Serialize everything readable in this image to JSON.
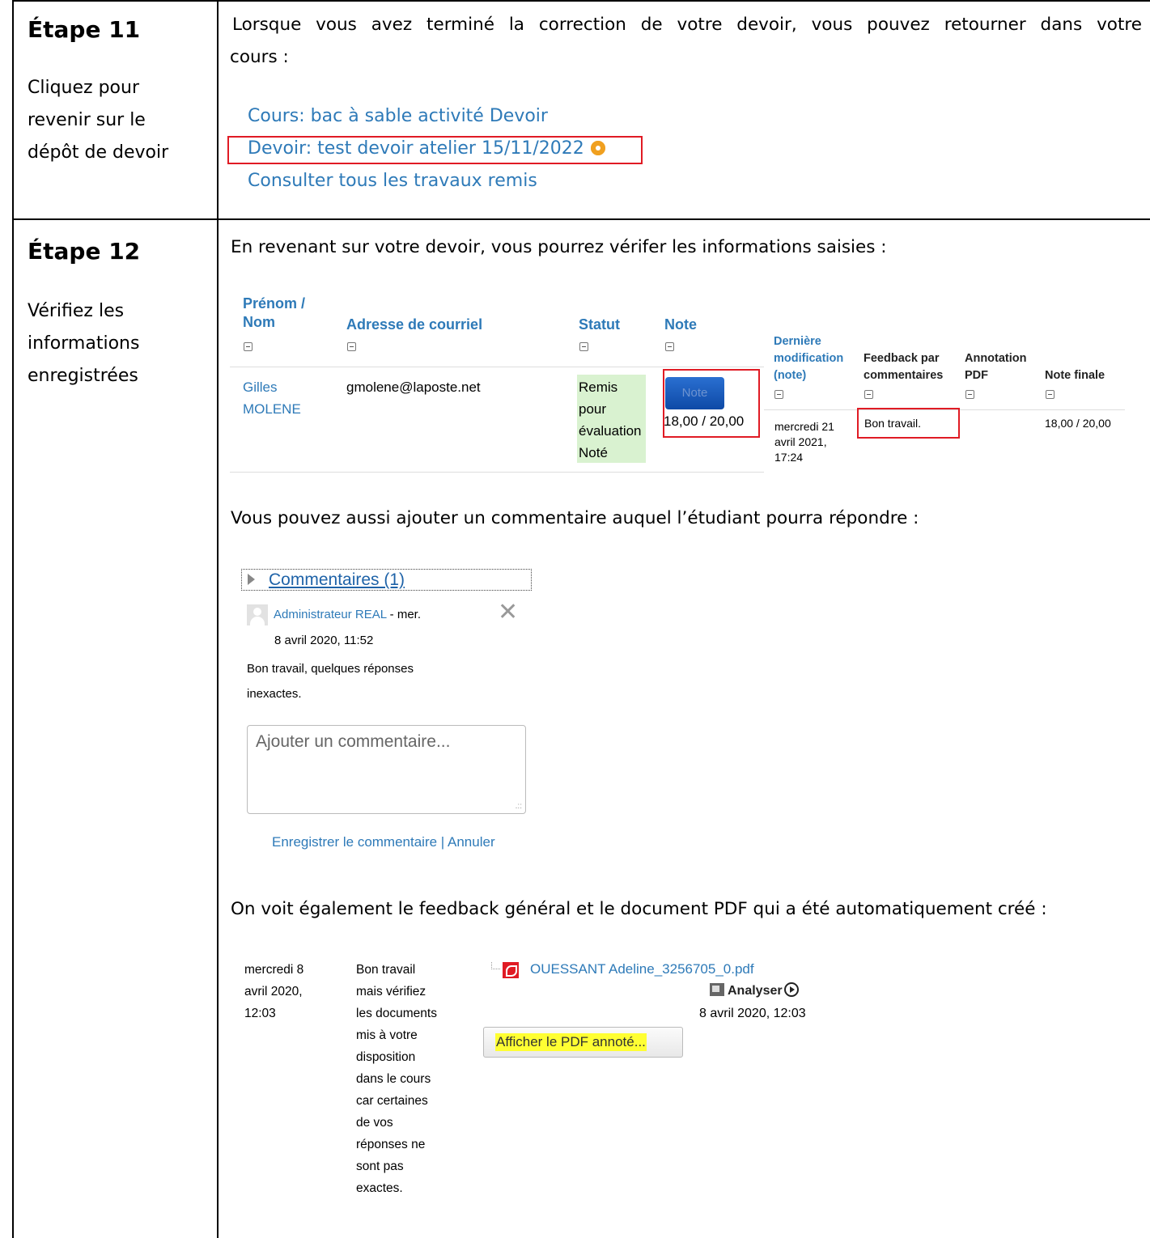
{
  "step11": {
    "title": "Étape 11",
    "subtitle_lines": [
      "Cliquez pour",
      "revenir sur le",
      "dépôt de devoir"
    ],
    "intro_lines": [
      "Lorsque vous avez terminé la correction de votre devoir, vous pouvez retourner dans votre",
      "cours :"
    ],
    "links": {
      "course": "Cours: bac à sable activité Devoir",
      "assignment": "Devoir: test devoir atelier 15/11/2022",
      "view_all": "Consulter tous les travaux remis"
    },
    "gear_icon": "gear-icon"
  },
  "step12": {
    "title": "Étape 12",
    "subtitle_lines": [
      "Vérifiez les",
      "informations",
      "enregistrées"
    ],
    "intro": "En revenant sur votre devoir, vous pourrez vérifer les informations saisies :",
    "table": {
      "headers": {
        "name": [
          "Prénom /",
          "Nom"
        ],
        "email": "Adresse de courriel",
        "status": "Statut",
        "grade": "Note",
        "last_modified": [
          "Dernière",
          "modification",
          "(note)"
        ],
        "feedback": [
          "Feedback par",
          "commentaires"
        ],
        "pdf_annotation": [
          "Annotation",
          "PDF"
        ],
        "final_grade": "Note finale"
      },
      "row": {
        "name": [
          "Gilles",
          "MOLENE"
        ],
        "email": "gmolene@laposte.net",
        "status": [
          "Remis",
          "pour",
          "évaluation",
          "Noté"
        ],
        "grade_button": "Note",
        "grade": "18,00 / 20,00",
        "last_modified": [
          "mercredi 21",
          "avril 2021,",
          "17:24"
        ],
        "feedback": "Bon travail.",
        "final_grade": "18,00 / 20,00"
      }
    },
    "comment_intro": "Vous pouvez aussi ajouter un commentaire auquel l’étudiant pourra répondre :",
    "comments": {
      "header": "Commentaires (1)",
      "author": "Administrateur REAL",
      "date_prefix": " - mer.",
      "date": "8 avril 2020, 11:52",
      "text_lines": [
        "Bon travail, quelques réponses",
        "inexactes."
      ],
      "placeholder": "Ajouter un commentaire...",
      "save": "Enregistrer le commentaire",
      "separator": " | ",
      "cancel": "Annuler"
    },
    "feedback_intro": "On voit également le feedback général et le document PDF qui a été automatiquement créé :",
    "feedback": {
      "date_lines": [
        "mercredi 8",
        "avril 2020,",
        "12:03"
      ],
      "text_lines": [
        "Bon travail",
        "mais vérifiez",
        "les documents",
        "mis à votre",
        "disposition",
        "dans le cours",
        "car certaines",
        "de vos",
        "réponses ne",
        "sont pas",
        "exactes."
      ],
      "file_name": "OUESSANT Adeline_3256705_0.pdf",
      "analyse": "Analyser",
      "file_date": "8 avril 2020, 12:03",
      "annotated_button": "Afficher le PDF annoté..."
    }
  }
}
